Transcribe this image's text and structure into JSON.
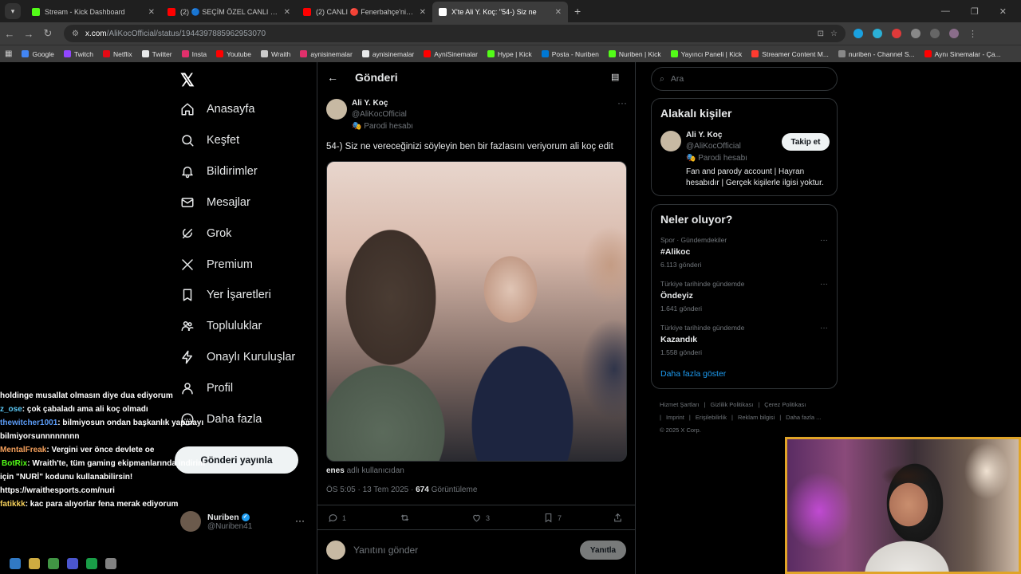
{
  "browser": {
    "tab_list_icon": "chevron-down-icon",
    "tabs": [
      {
        "title": "Stream - Kick Dashboard",
        "color": "#53fc18",
        "active": false
      },
      {
        "title": "(2) 🔵 SEÇİM ÖZEL CANLI | Kul",
        "color": "#ff0000",
        "active": false
      },
      {
        "title": "(2) CANLI 🔴 Fenerbahçe'nin Y",
        "color": "#ff0000",
        "active": false
      },
      {
        "title": "X'te Ali Y. Koç: \"54-) Siz ne",
        "color": "#ffffff",
        "active": true
      }
    ],
    "new_tab": "+",
    "url_domain": "x.com",
    "url_path": "/AliKocOfficial/status/1944397885962953070",
    "bookmarks": [
      {
        "label": "Google",
        "color": "#4285f4"
      },
      {
        "label": "Twitch",
        "color": "#9146ff"
      },
      {
        "label": "Netflix",
        "color": "#e50914"
      },
      {
        "label": "Twitter",
        "color": "#e7e9ea"
      },
      {
        "label": "Insta",
        "color": "#e1306c"
      },
      {
        "label": "Youtube",
        "color": "#ff0000"
      },
      {
        "label": "Wraith",
        "color": "#cccccc"
      },
      {
        "label": "aynisinemalar",
        "color": "#e1306c"
      },
      {
        "label": "aynisinemalar",
        "color": "#e7e9ea"
      },
      {
        "label": "AyniSinemalar",
        "color": "#ff0000"
      },
      {
        "label": "Hype | Kick",
        "color": "#53fc18"
      },
      {
        "label": "Posta - Nuriben",
        "color": "#0078d4"
      },
      {
        "label": "Nuriben | Kick",
        "color": "#53fc18"
      },
      {
        "label": "Yayıncı Paneli | Kick",
        "color": "#53fc18"
      },
      {
        "label": "Streamer Content M...",
        "color": "#ff3b30"
      },
      {
        "label": "nuriben - Channel S...",
        "color": "#888888"
      },
      {
        "label": "Aynı Sinemalar - Ça...",
        "color": "#ff0000"
      }
    ]
  },
  "nav": {
    "items": [
      {
        "label": "Anasayfa",
        "icon": "home-icon"
      },
      {
        "label": "Keşfet",
        "icon": "search-icon"
      },
      {
        "label": "Bildirimler",
        "icon": "bell-icon"
      },
      {
        "label": "Mesajlar",
        "icon": "mail-icon"
      },
      {
        "label": "Grok",
        "icon": "grok-icon"
      },
      {
        "label": "Premium",
        "icon": "x-icon"
      },
      {
        "label": "Yer İşaretleri",
        "icon": "bookmark-icon"
      },
      {
        "label": "Topluluklar",
        "icon": "communities-icon"
      },
      {
        "label": "Onaylı Kuruluşlar",
        "icon": "lightning-icon"
      },
      {
        "label": "Profil",
        "icon": "person-icon"
      },
      {
        "label": "Daha fazla",
        "icon": "more-circle-icon"
      }
    ],
    "post_button": "Gönderi yayınla",
    "account_name": "Nuriben",
    "account_handle": "@Nuriben41"
  },
  "post": {
    "header": "Gönderi",
    "author_name": "Ali Y. Koç",
    "author_handle": "@AliKocOfficial",
    "author_label": "Parodi hesabı",
    "text": "54-) Siz ne vereceğinizi söyleyin ben bir fazlasını veriyorum ali koç edit",
    "media_user": "enes",
    "media_user_suffix": "adlı kullanıcıdan",
    "timestamp": "ÖS 5:05 · 13 Tem 2025 ·",
    "views": "674",
    "views_label": "Görüntüleme",
    "replies": "1",
    "reposts": "",
    "likes": "3",
    "bookmarks": "7",
    "reply_placeholder": "Yanıtını gönder",
    "reply_button": "Yanıtla"
  },
  "sidebar": {
    "search_placeholder": "Ara",
    "related_title": "Alakalı kişiler",
    "related_name": "Ali Y. Koç",
    "related_handle": "@AliKocOfficial",
    "related_label": "Parodi hesabı",
    "related_bio": "Fan and parody account | Hayran hesabıdır | Gerçek kişilerle ilgisi yoktur.",
    "follow": "Takip et",
    "trends_title": "Neler oluyor?",
    "trends": [
      {
        "context": "Spor · Gündemdekiler",
        "name": "#Alikoc",
        "count": "6.113 gönderi"
      },
      {
        "context": "Türkiye tarihinde gündemde",
        "name": "Öndeyiz",
        "count": "1.641 gönderi"
      },
      {
        "context": "Türkiye tarihinde gündemde",
        "name": "Kazandık",
        "count": "1.558 gönderi"
      }
    ],
    "show_more": "Daha fazla göster",
    "footer": [
      "Hizmet Şartları",
      "|",
      "Gizlilik Politikası",
      "|",
      "Çerez Politikası",
      "|",
      "Imprint",
      "|",
      "Erişilebilirlik",
      "|",
      "Reklam bilgisi",
      "|",
      "Daha fazla ...",
      "© 2025 X Corp."
    ]
  },
  "chat": [
    {
      "user": "",
      "color": "#ffffff",
      "msg": "holdinge musallat olmasın diye dua ediyorum"
    },
    {
      "user": "z_ose",
      "color": "#5bc8f5",
      "msg": ": çok çabaladı ama ali koç olmadı"
    },
    {
      "user": "thewitcher1001",
      "color": "#5b9bf5",
      "msg": ": bilmiyosun ondan başkanlık yapmayı bilmiyorsunnnnnnnn"
    },
    {
      "user": "MentalFreak",
      "color": "#f5a05b",
      "msg": ": Vergini ver önce devlete oe"
    },
    {
      "user": "BotRix",
      "color": "#53fc18",
      "msg": ": Wraith'te, tüm gaming ekipmanlarında indirim için \"NURİ\" kodunu kullanabilirsin! https://wraithesports.com/nuri"
    },
    {
      "user": "fatikkk",
      "color": "#f5d05b",
      "msg": ": kac para alıyorlar fena merak ediyorum"
    }
  ]
}
